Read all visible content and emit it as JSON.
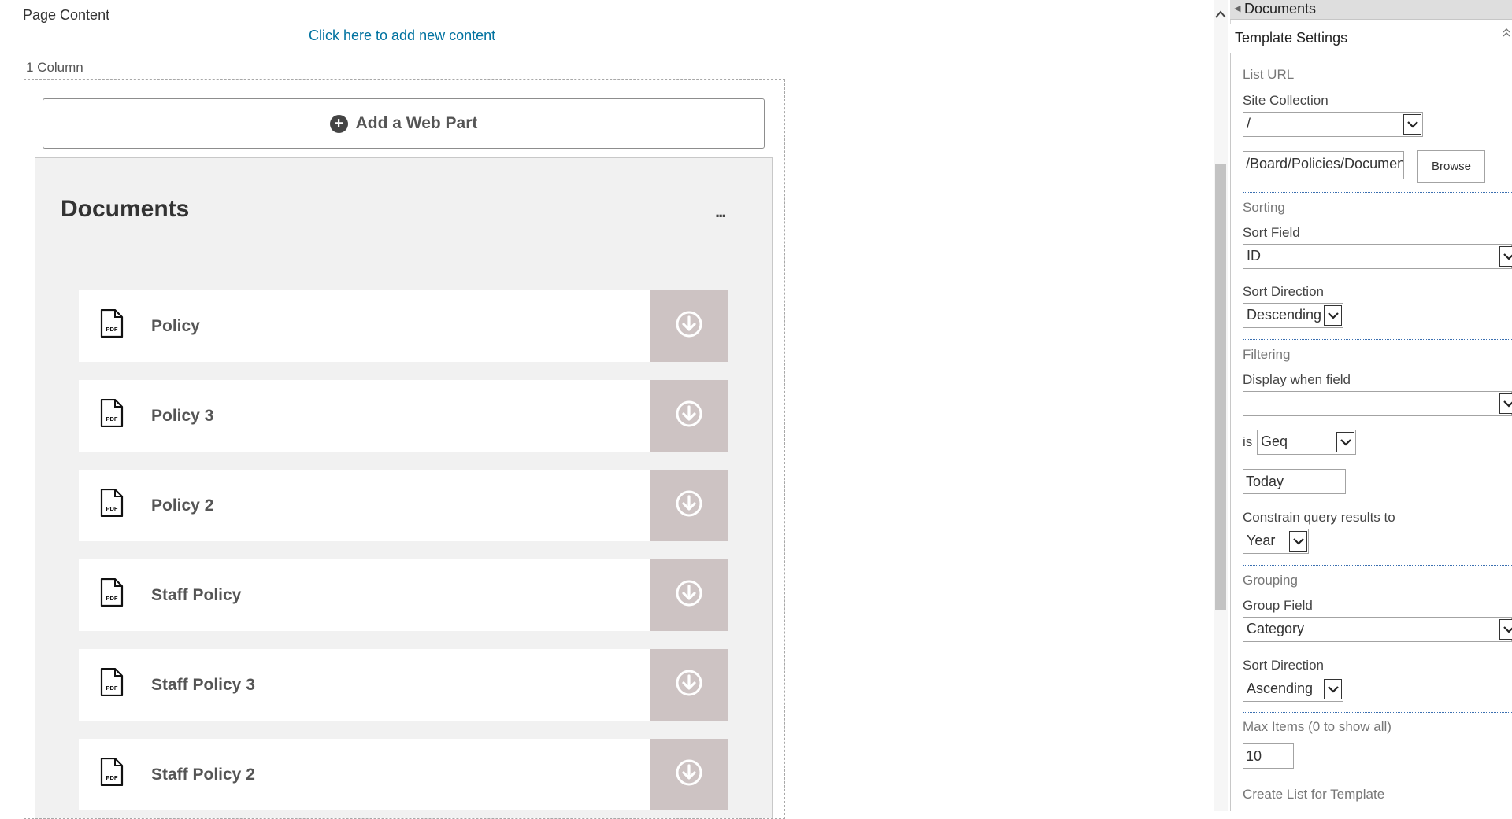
{
  "page": {
    "label": "Page Content",
    "add_content_link": "Click here to add new content",
    "zone_title": "1 Column",
    "add_webpart_label": "Add a Web Part"
  },
  "webpart": {
    "title": "Documents",
    "menu_label": "...",
    "documents": [
      {
        "title": "Policy",
        "icon": "pdf-file-icon"
      },
      {
        "title": "Policy 3",
        "icon": "pdf-file-icon"
      },
      {
        "title": "Policy 2",
        "icon": "pdf-file-icon"
      },
      {
        "title": "Staff Policy",
        "icon": "pdf-file-icon"
      },
      {
        "title": "Staff Policy 3",
        "icon": "pdf-file-icon"
      },
      {
        "title": "Staff Policy 2",
        "icon": "pdf-file-icon"
      }
    ],
    "pdf_icon_text": "PDF",
    "download_icon": "download-circle-icon",
    "download_bg": "#cdc3c3"
  },
  "panel": {
    "header_title": "Documents",
    "section_title": "Template Settings",
    "list_url": {
      "group": "List URL",
      "site_collection_label": "Site Collection",
      "site_collection_value": "/",
      "url_value": "/Board/Policies/Documents",
      "browse_label": "Browse"
    },
    "sorting": {
      "group": "Sorting",
      "sort_field_label": "Sort Field",
      "sort_field_value": "ID",
      "sort_direction_label": "Sort Direction",
      "sort_direction_value": "Descending"
    },
    "filtering": {
      "group": "Filtering",
      "display_when_label": "Display when field",
      "display_when_value": "",
      "is_label": "is",
      "operator_value": "Geq",
      "filter_value": "Today",
      "constrain_label": "Constrain query results to",
      "constrain_value": "Year"
    },
    "grouping": {
      "group": "Grouping",
      "group_field_label": "Group Field",
      "group_field_value": "Category",
      "sort_direction_label": "Sort Direction",
      "sort_direction_value": "Ascending"
    },
    "max_items": {
      "label": "Max Items (0 to show all)",
      "value": "10"
    },
    "create_list_label": "Create List for Template"
  }
}
